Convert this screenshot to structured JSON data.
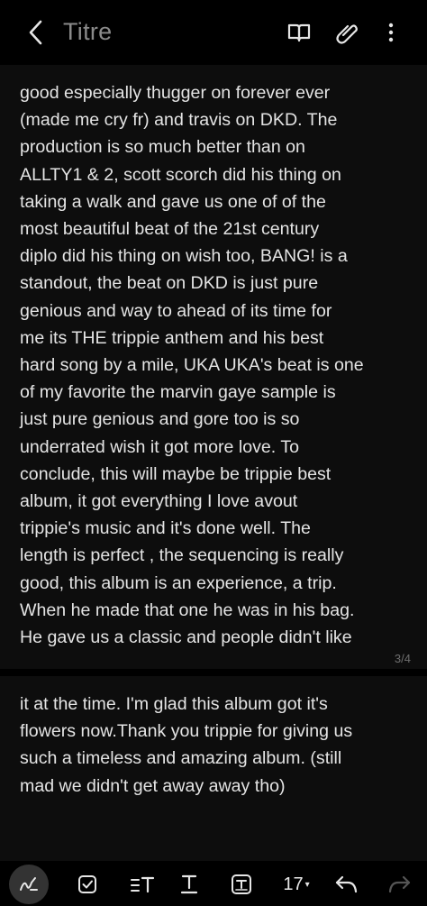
{
  "header": {
    "title": "Titre"
  },
  "pages": [
    {
      "text": "good especially thugger on forever ever\n(made me cry fr) and travis on DKD. The\nproduction is so much better than on\nALLTY1 & 2, scott scorch did his thing on\ntaking a walk and gave us one of of the\nmost beautiful beat of the 21st century\ndiplo did his thing on wish too, BANG! is a\nstandout, the beat on DKD is just pure\ngenious and way to ahead of its time for\nme its THE trippie anthem and his best\nhard song by a mile, UKA UKA's beat is one\nof my favorite the marvin gaye sample is\njust pure genious and gore too is so\nunderrated wish it got more love. To\nconclude, this will maybe be trippie best\nalbum, it got everything I love avout\ntrippie's music and it's done well. The\nlength is perfect , the sequencing is really\ngood, this album is an experience, a trip.\nWhen he made that one he was in his bag.\nHe gave us a classic and people didn't like",
      "page_number": "3/4"
    },
    {
      "text": "it at the time. I'm glad this album got it's\nflowers now.Thank you trippie for giving us\nsuch a timeless and amazing album. (still\nmad we didn't get away away tho)"
    }
  ],
  "toolbar": {
    "font_size": "17",
    "font_size_caret": "▾"
  },
  "icons": {
    "back": "chevron-left-icon",
    "reading_mode": "book-icon",
    "attach": "paperclip-icon",
    "more": "more-vertical-icon",
    "pen": "handwriting-icon",
    "checkbox": "checkbox-icon",
    "text_style": "text-size-icon",
    "underline": "underline-icon",
    "textbox": "textbox-icon",
    "undo": "undo-icon",
    "redo": "redo-icon"
  },
  "colors": {
    "background": "#000000",
    "page": "#0d0d0d",
    "title": "#8a8a8a",
    "text": "#e4e4e4",
    "page_number": "#6e6e6e",
    "pen_button_bg": "#333333",
    "redo_disabled": "#555555"
  }
}
